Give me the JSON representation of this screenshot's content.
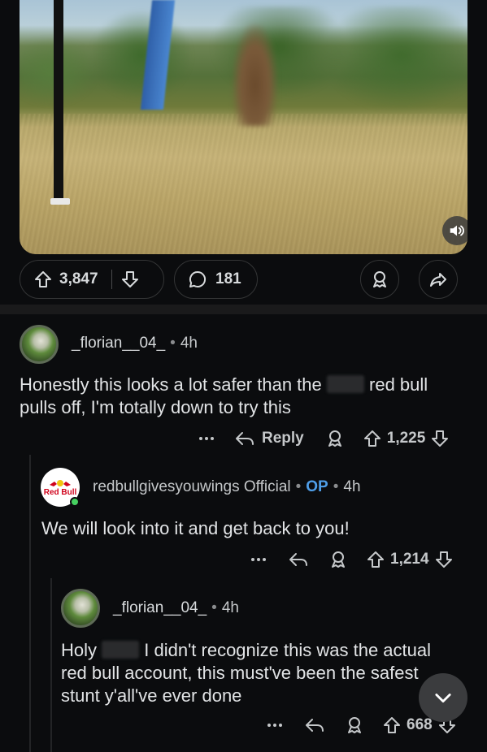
{
  "post": {
    "upvotes": "3,847",
    "comments": "181"
  },
  "comments": [
    {
      "username": "_florian__04_",
      "time": "4h",
      "text_before": "Honestly this looks a lot safer than the",
      "text_after": "red bull",
      "text_line2": "pulls off, I'm totally down to try this",
      "reply_label": "Reply",
      "score": "1,225"
    },
    {
      "username": "redbullgivesyouwings",
      "flair": "Official",
      "op_badge": "OP",
      "time": "4h",
      "avatar_text": "Red Bull",
      "text": "We will look into it and get back to you!",
      "score": "1,214"
    },
    {
      "username": "_florian__04_",
      "time": "4h",
      "line1_before": "Holy",
      "line1_after": "I didn't recognize this was the actual",
      "line2": "red bull account, this must've been the safest",
      "line3": "stunt y'all've ever done",
      "score": "668"
    }
  ],
  "colors": {
    "background": "#0b0c0e",
    "op_badge": "#4f9ee8",
    "online": "#46d160"
  },
  "icons": [
    "upvote-icon",
    "downvote-icon",
    "comment-icon",
    "award-icon",
    "share-icon",
    "speaker-icon",
    "more-icon",
    "reply-icon",
    "chevron-down-icon"
  ]
}
